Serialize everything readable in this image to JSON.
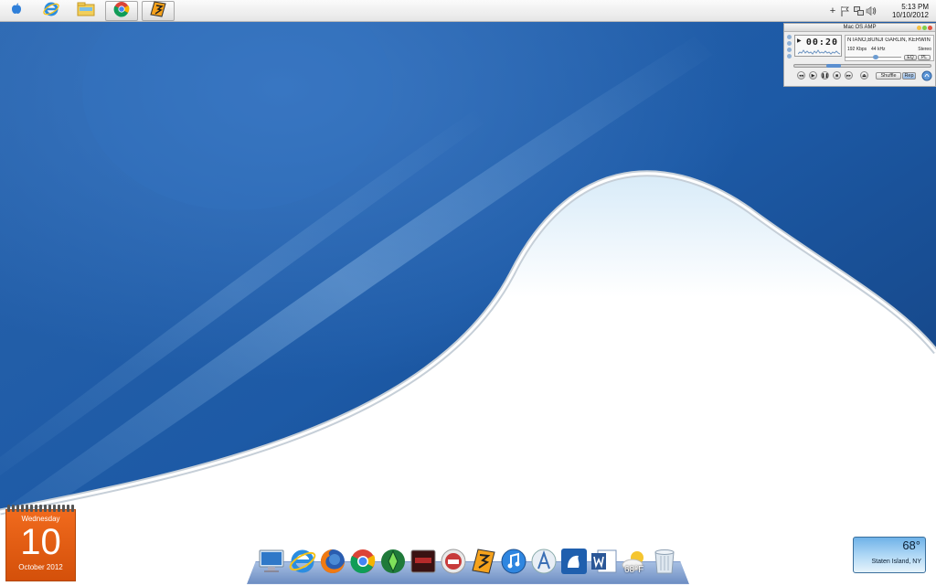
{
  "taskbar": {
    "buttons": [
      {
        "name": "apple-menu",
        "icon": "apple-icon"
      },
      {
        "name": "internet-explorer",
        "icon": "ie-icon"
      },
      {
        "name": "file-explorer",
        "icon": "folder-icon"
      },
      {
        "name": "google-chrome",
        "icon": "chrome-icon"
      },
      {
        "name": "winamp",
        "icon": "winamp-icon"
      }
    ],
    "tray": {
      "icons": [
        "plus-icon",
        "flag-icon",
        "network-icon",
        "volume-icon"
      ],
      "time": "5:13 PM",
      "date": "10/10/2012"
    }
  },
  "amp": {
    "title": "Mac OS AMP",
    "time": "00:20",
    "song": "NTANO,BUNJI GARLIN, KERWIN",
    "kbps": "192 Kbps",
    "khz": "44 kHz",
    "stereo": "Stereo",
    "eq_label": "EQ",
    "pl_label": "PL",
    "shuffle_label": "Shuffle",
    "repeat_label": "Rep",
    "seek_position": 0.26,
    "volume_level": 0.55
  },
  "calendar": {
    "weekday": "Wednesday",
    "day": "10",
    "month_year": "October 2012"
  },
  "weather_widget": {
    "temperature": "68°",
    "city": "Staten Island, NY"
  },
  "dock": {
    "items": [
      "computer-icon",
      "ie-icon",
      "firefox-icon",
      "chrome-icon",
      "sims-icon",
      "media-icon",
      "itunes-store-icon",
      "winamp-icon",
      "itunes-icon",
      "app-store-icon",
      "frog-app-icon",
      "word-icon",
      "weather-icon",
      "trash-icon"
    ],
    "weather_temp": "68°F"
  },
  "colors": {
    "wallpaper_blue": "#1c4f93",
    "calendar_orange": "#e8611a",
    "taskbar": "#eeeeee"
  }
}
